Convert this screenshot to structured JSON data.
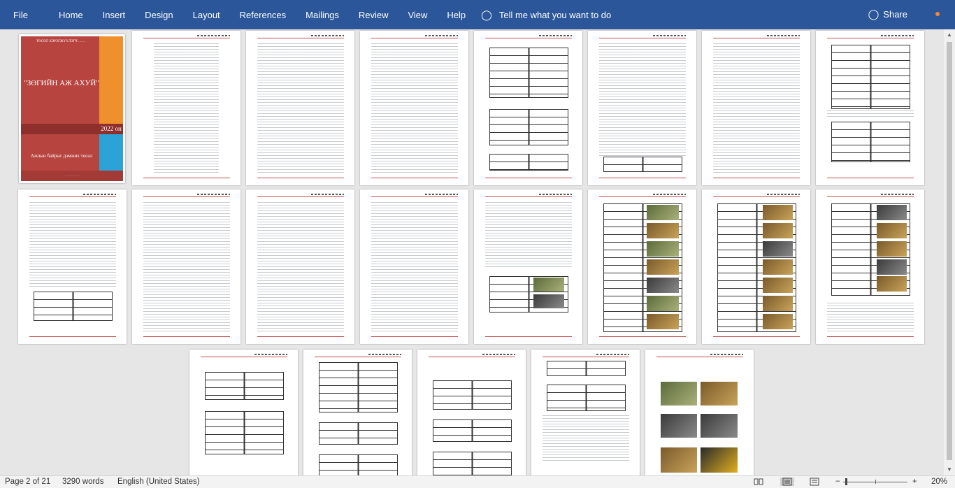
{
  "menu": {
    "file": "File",
    "home": "Home",
    "insert": "Insert",
    "design": "Design",
    "layout": "Layout",
    "references": "References",
    "mailings": "Mailings",
    "review": "Review",
    "view": "View",
    "help": "Help",
    "tell_me": "Tell me what you want to do",
    "share": "Share"
  },
  "icons": {
    "tell_me": "lightbulb-icon",
    "share": "person-icon",
    "read_mode": "book-icon",
    "print_layout": "page-icon",
    "web_layout": "web-icon"
  },
  "cover": {
    "top_text": "ТӨСӨЛ ХЭРЭГЖҮҮЛЭГЧ ……",
    "title": "\"ЗӨГИЙН АЖ АХУЙ\"",
    "year": "2022 он",
    "subtitle": "Ажлын байрыг дэмжих төсөл",
    "bottom_text": "……… ……"
  },
  "status": {
    "page": "Page 2 of 21",
    "words": "3290 words",
    "language": "English (United States)",
    "zoom_minus": "−",
    "zoom_plus": "+",
    "zoom": "20%"
  },
  "colors": {
    "ribbon": "#2b579a",
    "cover_red": "#b7443f",
    "cover_orange": "#f0902d",
    "cover_blue": "#2ba3d6"
  }
}
